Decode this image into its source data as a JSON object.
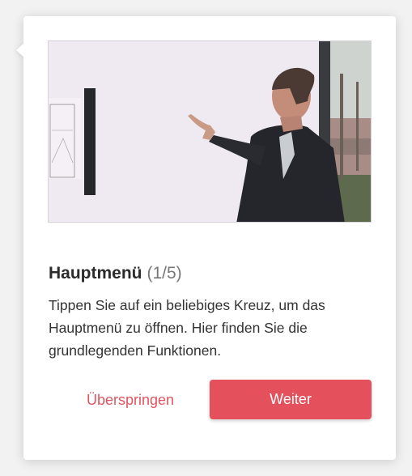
{
  "tour": {
    "title": "Hauptmenü",
    "step": "(1/5)",
    "description": "Tippen Sie auf ein beliebiges Kreuz, um das Hauptmenü zu öffnen. Hier finden Sie die grundlegenden Funktionen.",
    "skip_label": "Überspringen",
    "next_label": "Weiter",
    "media_icon": "video-thumbnail-presenter-at-whiteboard"
  },
  "colors": {
    "accent": "#e4505c",
    "skip_text": "#e2545f",
    "title_text": "#2b2b2b"
  }
}
